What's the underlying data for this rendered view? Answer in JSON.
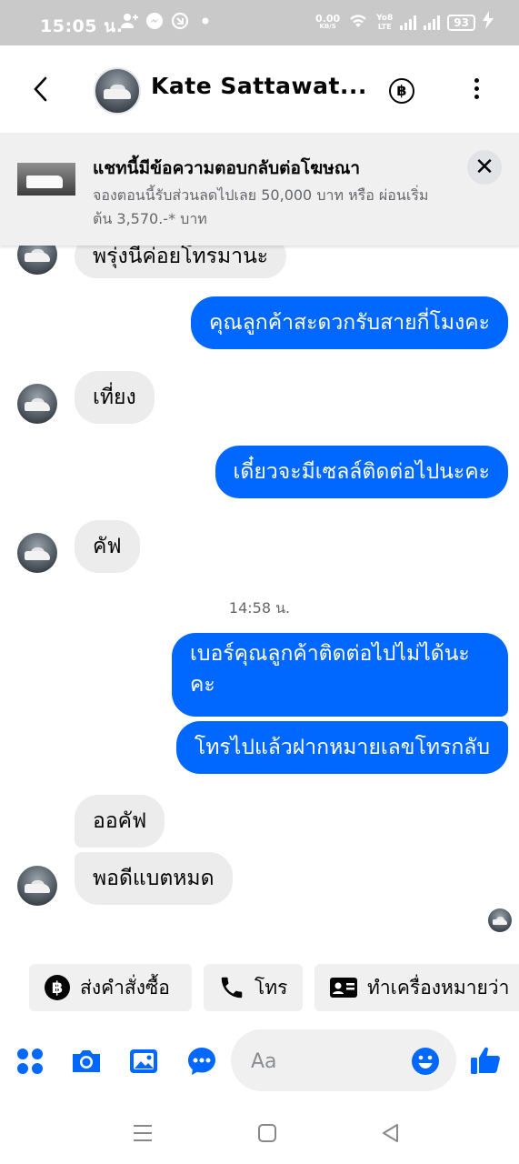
{
  "status_bar": {
    "time": "15:05 น.",
    "net_speed_value": "0.00",
    "net_speed_unit": "KB/S",
    "volte_top": "Yo8",
    "volte_bottom": "LTE",
    "battery": "93"
  },
  "header": {
    "contact_name": "Kate Sattawat...",
    "baht_symbol": "฿"
  },
  "ad_banner": {
    "title": "แชทนี้มีข้อความตอบกลับต่อโฆษณา",
    "description": "จองตอนนี้รับส่วนลดไปเลย 50,000 บาท หรือ ผ่อนเริ่มต้น 3,570.-* บาท"
  },
  "messages": [
    {
      "dir": "in",
      "text": "พรุ่งนี้ค่อยโทรมานะ"
    },
    {
      "dir": "out",
      "text": "คุณลูกค้าสะดวกรับสายกี่โมงคะ"
    },
    {
      "dir": "in",
      "text": "เที่ยง"
    },
    {
      "dir": "out",
      "text": "เดี๋ยวจะมีเซลล์ติดต่อไปนะคะ"
    },
    {
      "dir": "in",
      "text": "คัฟ"
    },
    {
      "dir": "out",
      "text": "เบอร์คุณลูกค้าติดต่อไปไม่ได้นะ"
    },
    {
      "dir": "out",
      "text": "คะ"
    },
    {
      "dir": "out",
      "text": "โทรไปแล้วฝากหมายเลขโทรกลับ"
    },
    {
      "dir": "in",
      "text": "ออคัฟ"
    },
    {
      "dir": "in",
      "text": "พอดีแบตหมด"
    }
  ],
  "timestamp": "14:58 น.",
  "quick_actions": [
    {
      "label": "ส่งคำสั่งซื้อ",
      "icon": "baht-icon"
    },
    {
      "label": "โทร",
      "icon": "phone-icon"
    },
    {
      "label": "ทำเครื่องหมายว่า",
      "icon": "contact-card-icon"
    }
  ],
  "composer": {
    "placeholder": "Aa"
  },
  "colors": {
    "accent": "#0068ff",
    "incoming_bubble": "#ececec",
    "banner_bg": "#f0f0f0"
  }
}
